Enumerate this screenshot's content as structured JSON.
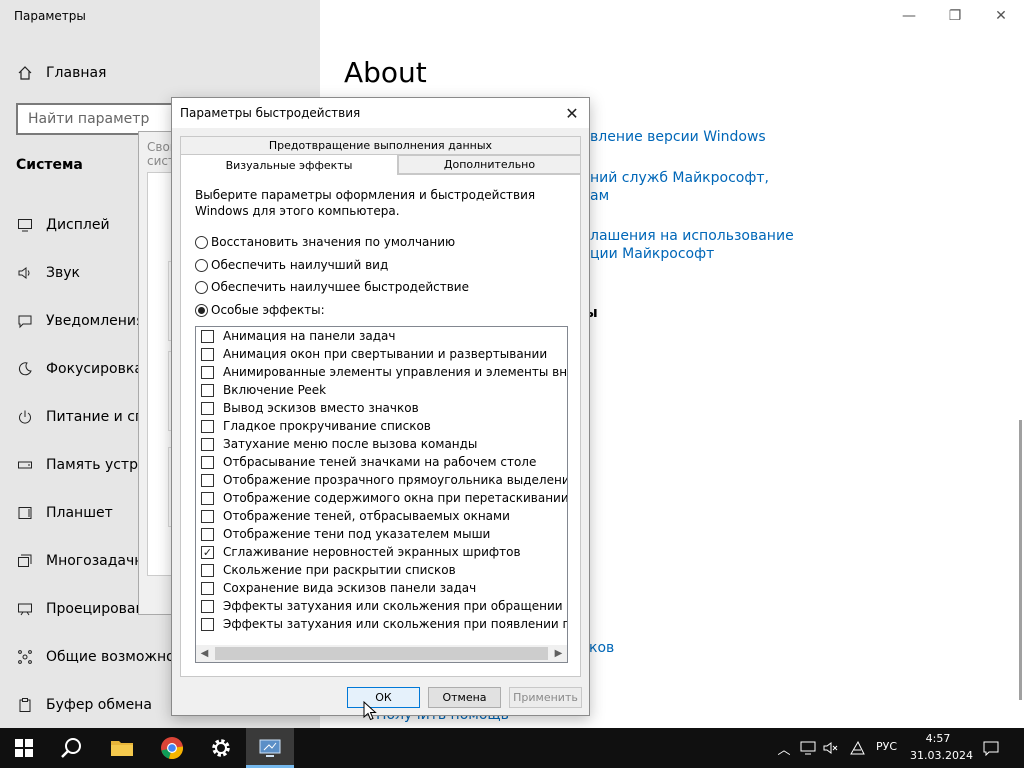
{
  "settings": {
    "app_title": "Параметры",
    "home_label": "Главная",
    "search_placeholder": "Найти параметр",
    "section_title": "Система",
    "nav_items": [
      {
        "label": "Дисплей"
      },
      {
        "label": "Звук"
      },
      {
        "label": "Уведомления и действия"
      },
      {
        "label": "Фокусировка внимания"
      },
      {
        "label": "Питание и спящий режим"
      },
      {
        "label": "Память устройства"
      },
      {
        "label": "Планшет"
      },
      {
        "label": "Многозадачность"
      },
      {
        "label": "Проецирование на этот компьютер"
      },
      {
        "label": "Общие возможности"
      },
      {
        "label": "Буфер обмена"
      }
    ],
    "page_title": "About",
    "links": [
      "вление версии Windows",
      "ний служб Майкрософт,",
      "ам",
      "лашения на использование",
      "ции Майкрософт"
    ],
    "related_heading": "ы",
    "bottom_link_1": "ков",
    "bottom_link_2": "Получить помощь"
  },
  "background_dialog": {
    "title": "Свойства системы"
  },
  "perf_dialog": {
    "title": "Параметры быстродействия",
    "close_label": "✕",
    "tabs": {
      "dep": "Предотвращение выполнения данных",
      "visual": "Визуальные эффекты",
      "advanced": "Дополнительно"
    },
    "description": "Выберите параметры оформления и быстродействия Windows для этого компьютера.",
    "radios": [
      {
        "label": "Восстановить значения по умолчанию",
        "selected": false
      },
      {
        "label": "Обеспечить наилучший вид",
        "selected": false
      },
      {
        "label": "Обеспечить наилучшее быстродействие",
        "selected": false
      },
      {
        "label": "Особые эффекты:",
        "selected": true
      }
    ],
    "effects": [
      {
        "label": "Анимация на панели задач",
        "checked": false
      },
      {
        "label": "Анимация окон при свертывании и развертывании",
        "checked": false
      },
      {
        "label": "Анимированные элементы управления и элементы внутри окна",
        "checked": false
      },
      {
        "label": "Включение Peek",
        "checked": false
      },
      {
        "label": "Вывод эскизов вместо значков",
        "checked": false
      },
      {
        "label": "Гладкое прокручивание списков",
        "checked": false
      },
      {
        "label": "Затухание меню после вызова команды",
        "checked": false
      },
      {
        "label": "Отбрасывание теней значками на рабочем столе",
        "checked": false
      },
      {
        "label": "Отображение прозрачного прямоугольника выделения",
        "checked": false
      },
      {
        "label": "Отображение содержимого окна при перетаскивании",
        "checked": false
      },
      {
        "label": "Отображение теней, отбрасываемых окнами",
        "checked": false
      },
      {
        "label": "Отображение тени под указателем мыши",
        "checked": false
      },
      {
        "label": "Сглаживание неровностей экранных шрифтов",
        "checked": true
      },
      {
        "label": "Скольжение при раскрытии списков",
        "checked": false
      },
      {
        "label": "Сохранение вида эскизов панели задач",
        "checked": false
      },
      {
        "label": "Эффекты затухания или скольжения при обращении к меню",
        "checked": false
      },
      {
        "label": "Эффекты затухания или скольжения при появлении подсказок",
        "checked": false
      }
    ],
    "buttons": {
      "ok": "ОК",
      "cancel": "Отмена",
      "apply": "Применить"
    }
  },
  "taskbar": {
    "language": "РУС",
    "time": "4:57",
    "date": "31.03.2024"
  },
  "colors": {
    "link": "#0067b8",
    "taskbar": "#101010",
    "left_pane": "#e6e6e6",
    "dialog_bg": "#f0f0f0"
  }
}
